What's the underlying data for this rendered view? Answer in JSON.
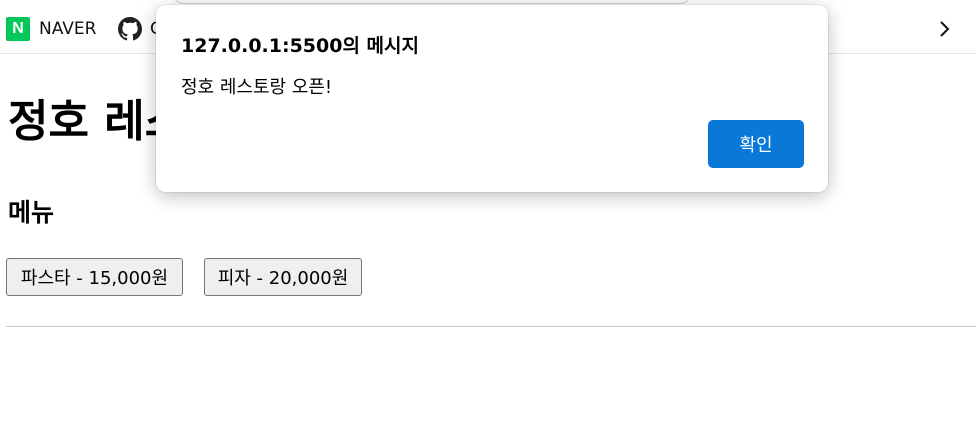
{
  "bookmarks": {
    "naver": {
      "label": "NAVER",
      "icon": "naver-logo-icon",
      "logo_letter": "N"
    },
    "github": {
      "label": "G",
      "icon": "github-icon"
    },
    "overflow_icon": "chevron-right-icon"
  },
  "page": {
    "title": "정호 레스토랑",
    "menu_heading": "메뉴",
    "menu_items": [
      {
        "label": "파스타 - 15,000원"
      },
      {
        "label": "피자 - 20,000원"
      }
    ]
  },
  "alert": {
    "origin": "127.0.0.1:5500의 메시지",
    "message": "정호 레스토랑 오픈!",
    "ok_label": "확인"
  },
  "colors": {
    "naver_green": "#03c75a",
    "dialog_button_blue": "#0a78d7"
  }
}
